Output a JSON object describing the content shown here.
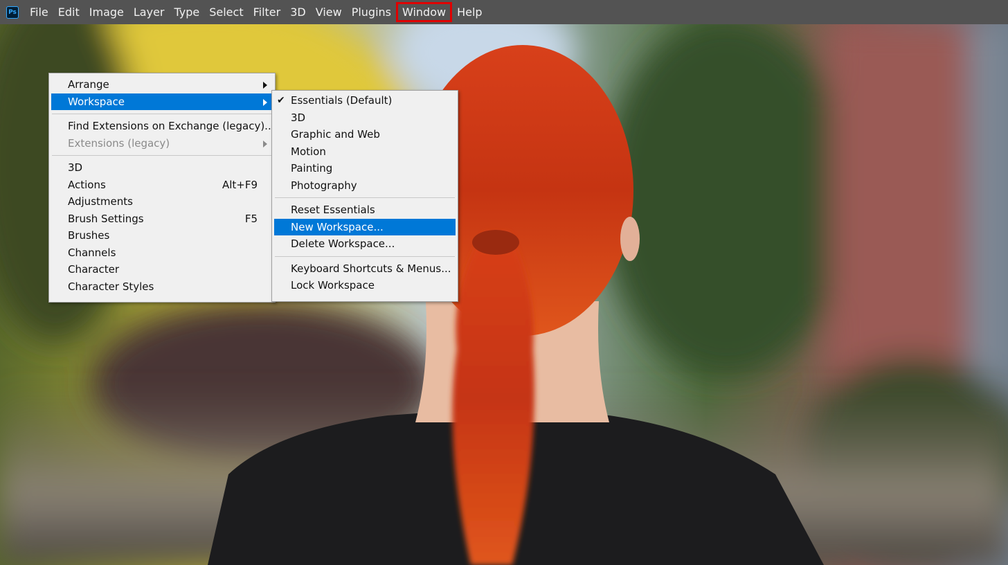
{
  "app": {
    "logo_text": "Ps",
    "accent": "#31a8ff"
  },
  "menubar": {
    "items": [
      "File",
      "Edit",
      "Image",
      "Layer",
      "Type",
      "Select",
      "Filter",
      "3D",
      "View",
      "Plugins",
      "Window",
      "Help"
    ],
    "active_item": "Window",
    "highlight_color": "#e00000"
  },
  "window_menu": {
    "arrange": "Arrange",
    "workspace": "Workspace",
    "find_extensions": "Find Extensions on Exchange (legacy)...",
    "extensions": "Extensions (legacy)",
    "three_d": "3D",
    "actions": "Actions",
    "actions_shortcut": "Alt+F9",
    "adjustments": "Adjustments",
    "brush_settings": "Brush Settings",
    "brush_settings_shortcut": "F5",
    "brushes": "Brushes",
    "channels": "Channels",
    "character": "Character",
    "character_styles": "Character Styles"
  },
  "workspace_menu": {
    "check_glyph": "✔",
    "essentials": "Essentials (Default)",
    "three_d": "3D",
    "graphic_web": "Graphic and Web",
    "motion": "Motion",
    "painting": "Painting",
    "photography": "Photography",
    "reset_essentials": "Reset Essentials",
    "new_workspace": "New Workspace...",
    "delete_workspace": "Delete Workspace...",
    "keyboard_shortcuts": "Keyboard Shortcuts & Menus...",
    "lock_workspace": "Lock Workspace"
  },
  "colors": {
    "menu_bg": "#f0f0f0",
    "menu_highlight": "#0078d7",
    "menubar_bg": "#535353"
  }
}
